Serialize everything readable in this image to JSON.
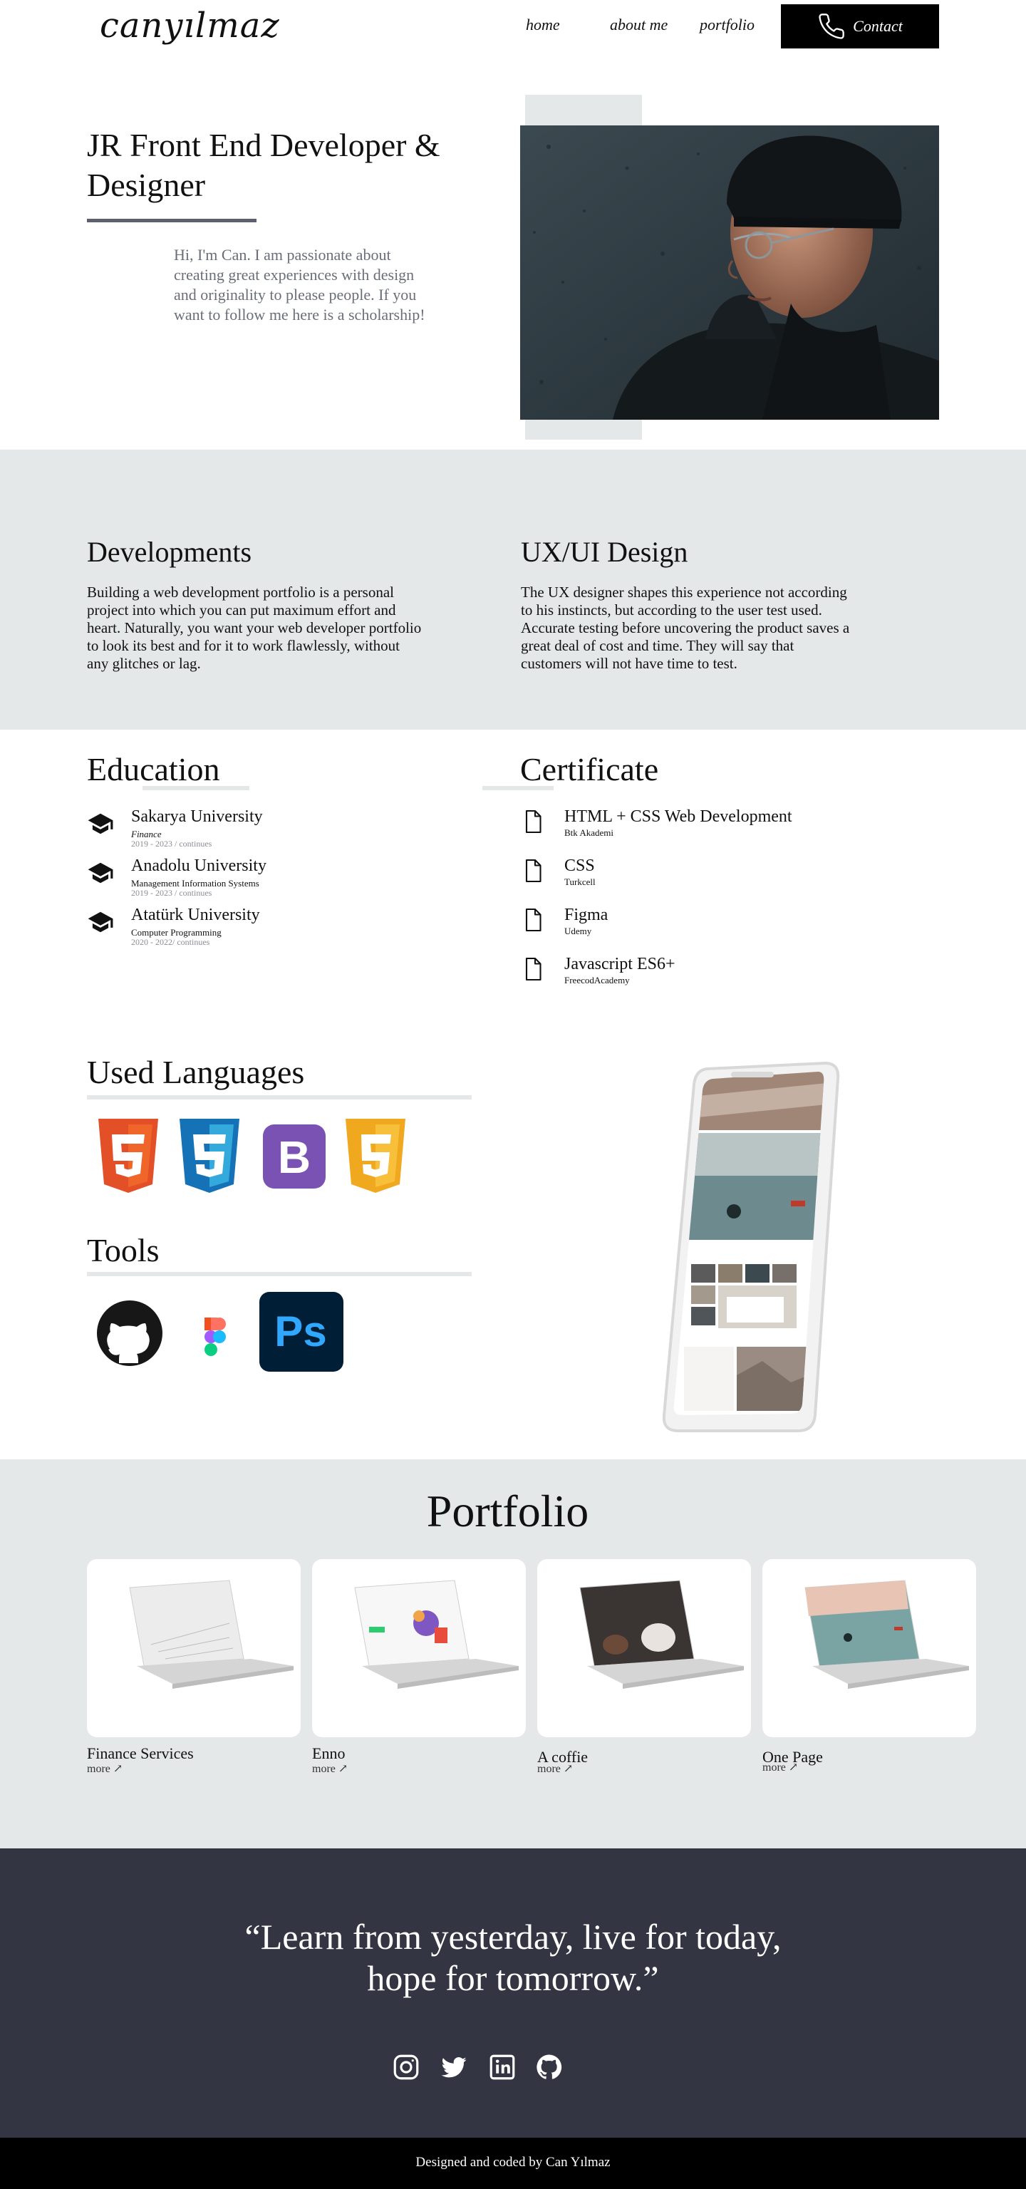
{
  "nav": {
    "logo": "canyılmaz",
    "links": [
      "home",
      "about me",
      "portfolio"
    ],
    "contact_label": "Contact"
  },
  "hero": {
    "title": "JR Front End Developer & Designer",
    "text": "Hi, I'm Can. I am passionate about creating great experiences with design and originality to please people. If you want to follow me here is a scholarship!"
  },
  "services": [
    {
      "title": "Developments",
      "text": "Building a web development portfolio is a personal project into which you can put maximum effort and heart. Naturally, you want your web developer portfolio to look its best and for it to work flawlessly, without any glitches or lag."
    },
    {
      "title": "UX/UI Design",
      "text": "The UX designer shapes this experience not according to his instincts, but according to the user test used. Accurate testing before uncovering the product saves a great deal of cost and time. They will say that customers will not have time to test."
    }
  ],
  "education": {
    "heading": "Education",
    "items": [
      {
        "name": "Sakarya University",
        "sub": "Finance",
        "date": "2019 - 2023 / continues"
      },
      {
        "name": "Anadolu University",
        "sub": "Management Information Systems",
        "date": "2019 - 2023 / continues"
      },
      {
        "name": "Atatürk University",
        "sub": "Computer Programming",
        "date": "2020 - 2022/ continues"
      }
    ]
  },
  "certificate": {
    "heading": "Certificate",
    "items": [
      {
        "name": "HTML + CSS Web Development",
        "sub": "Btk Akademi"
      },
      {
        "name": "CSS",
        "sub": "Turkcell"
      },
      {
        "name": "Figma",
        "sub": "Udemy"
      },
      {
        "name": "Javascript ES6+",
        "sub": "FreecodAcademy"
      }
    ]
  },
  "languages": {
    "heading": "Used Languages",
    "icons": [
      "html5-icon",
      "css3-icon",
      "bootstrap-icon",
      "javascript-icon"
    ],
    "bootstrap_letter": "B"
  },
  "tools": {
    "heading": "Tools",
    "icons": [
      "github-icon",
      "figma-icon",
      "photoshop-icon"
    ],
    "ps_label": "Ps"
  },
  "portfolio": {
    "heading": "Portfolio",
    "items": [
      {
        "name": "Finance Services",
        "more": "more ↗"
      },
      {
        "name": "Enno",
        "more": "more ↗"
      },
      {
        "name": "A coffie",
        "more": "more ↗"
      },
      {
        "name": "One Page",
        "more": "more ↗"
      }
    ]
  },
  "quote": {
    "line1": "“Learn from yesterday, live for today,",
    "line2": "hope for tomorrow.”",
    "social_icons": [
      "instagram-icon",
      "twitter-icon",
      "linkedin-icon",
      "github-icon"
    ]
  },
  "footer": {
    "text": "Designed and coded by Can Yılmaz"
  },
  "colors": {
    "gray_band": "#e5e8e8",
    "dark_band": "#333642",
    "accent_line": "#5b5f6e",
    "muted_text": "#6a6e78"
  }
}
